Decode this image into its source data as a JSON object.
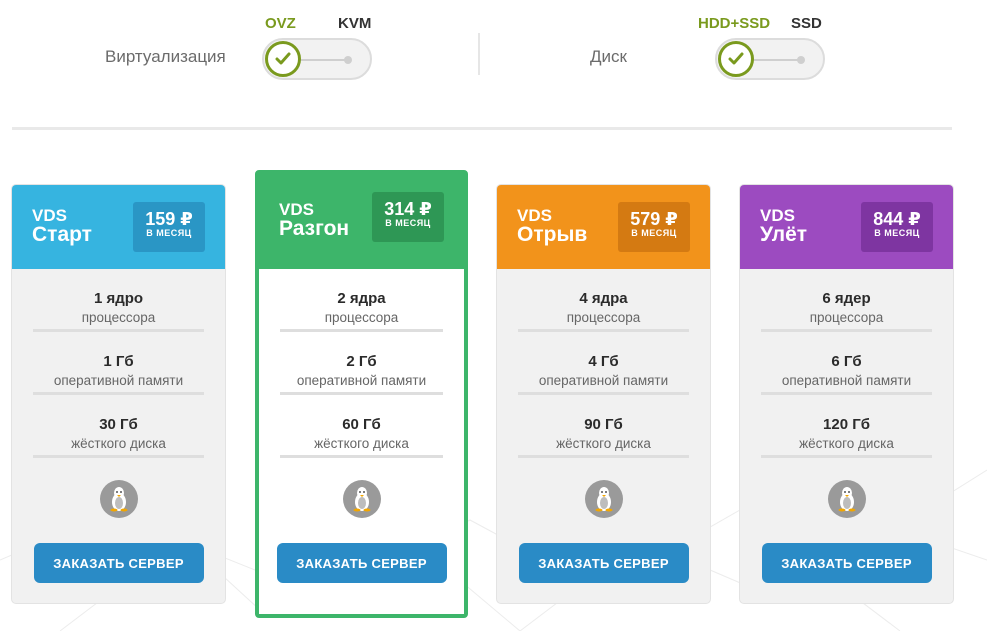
{
  "filters": {
    "virtualization": {
      "label": "Виртуализация",
      "options": [
        "OVZ",
        "KVM"
      ],
      "selected": "OVZ"
    },
    "disk": {
      "label": "Диск",
      "options": [
        "HDD+SSD",
        "SSD"
      ],
      "selected": "HDD+SSD"
    }
  },
  "colors": {
    "accent_green": "#7a9a1e",
    "start": "#36b4e0",
    "razgon": "#3db56a",
    "otryv": "#f2931b",
    "ulet": "#9c4bc0",
    "button": "#2a8bc6"
  },
  "plans": [
    {
      "prefix": "VDS",
      "name": "Старт",
      "price": "159 ₽",
      "period": "В МЕСЯЦ",
      "specs": [
        {
          "value": "1 ядро",
          "unit": "процессора"
        },
        {
          "value": "1 Гб",
          "unit": "оперативной памяти"
        },
        {
          "value": "30 Гб",
          "unit": "жёсткого диска"
        }
      ],
      "os_icon": "linux-tux-icon",
      "button": "ЗАКАЗАТЬ СЕРВЕР"
    },
    {
      "prefix": "VDS",
      "name": "Разгон",
      "price": "314 ₽",
      "period": "В МЕСЯЦ",
      "highlighted": true,
      "specs": [
        {
          "value": "2 ядра",
          "unit": "процессора"
        },
        {
          "value": "2 Гб",
          "unit": "оперативной памяти"
        },
        {
          "value": "60 Гб",
          "unit": "жёсткого диска"
        }
      ],
      "os_icon": "linux-tux-icon",
      "button": "ЗАКАЗАТЬ СЕРВЕР"
    },
    {
      "prefix": "VDS",
      "name": "Отрыв",
      "price": "579 ₽",
      "period": "В МЕСЯЦ",
      "specs": [
        {
          "value": "4 ядра",
          "unit": "процессора"
        },
        {
          "value": "4 Гб",
          "unit": "оперативной памяти"
        },
        {
          "value": "90 Гб",
          "unit": "жёсткого диска"
        }
      ],
      "os_icon": "linux-tux-icon",
      "button": "ЗАКАЗАТЬ СЕРВЕР"
    },
    {
      "prefix": "VDS",
      "name": "Улёт",
      "price": "844 ₽",
      "period": "В МЕСЯЦ",
      "specs": [
        {
          "value": "6 ядер",
          "unit": "процессора"
        },
        {
          "value": "6 Гб",
          "unit": "оперативной памяти"
        },
        {
          "value": "120 Гб",
          "unit": "жёсткого диска"
        }
      ],
      "os_icon": "linux-tux-icon",
      "button": "ЗАКАЗАТЬ СЕРВЕР"
    }
  ]
}
